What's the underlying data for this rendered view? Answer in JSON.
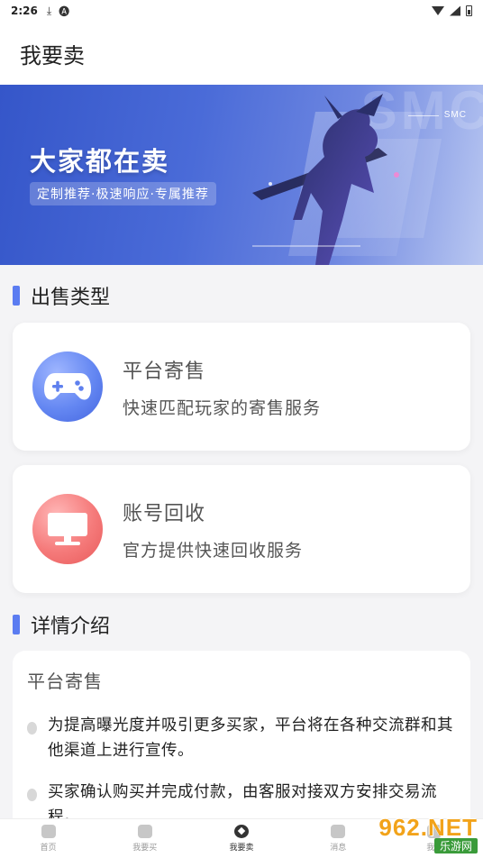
{
  "status_bar": {
    "time": "2:26",
    "icons": [
      "download-icon",
      "a-icon"
    ]
  },
  "header": {
    "title": "我要卖"
  },
  "banner": {
    "headline": "大家都在卖",
    "tagline": "定制推荐·极速响应·专属推荐",
    "watermark": "SMC",
    "brand": "SMC"
  },
  "sections": {
    "sale_types_title": "出售类型",
    "details_title": "详情介绍"
  },
  "cards": [
    {
      "title": "平台寄售",
      "desc": "快速匹配玩家的寄售服务",
      "icon": "gamepad-icon",
      "color": "#5f80ee"
    },
    {
      "title": "账号回收",
      "desc": "官方提供快速回收服务",
      "icon": "monitor-icon",
      "color": "#ef6b6b"
    }
  ],
  "details": {
    "title": "平台寄售",
    "items": [
      "为提高曝光度并吸引更多买家，平台将在各种交流群和其他渠道上进行宣传。",
      "买家确认购买并完成付款，由客服对接双方安排交易流程。"
    ]
  },
  "bottom_nav": [
    {
      "label": "首页",
      "icon": "home-icon",
      "active": false
    },
    {
      "label": "我要买",
      "icon": "shop-icon",
      "active": false
    },
    {
      "label": "我要卖",
      "icon": "sell-icon",
      "active": true
    },
    {
      "label": "消息",
      "icon": "message-icon",
      "active": false
    },
    {
      "label": "我的",
      "icon": "profile-icon",
      "active": false
    }
  ],
  "site_watermark": {
    "main": "962.NET",
    "sub": "乐游网"
  }
}
